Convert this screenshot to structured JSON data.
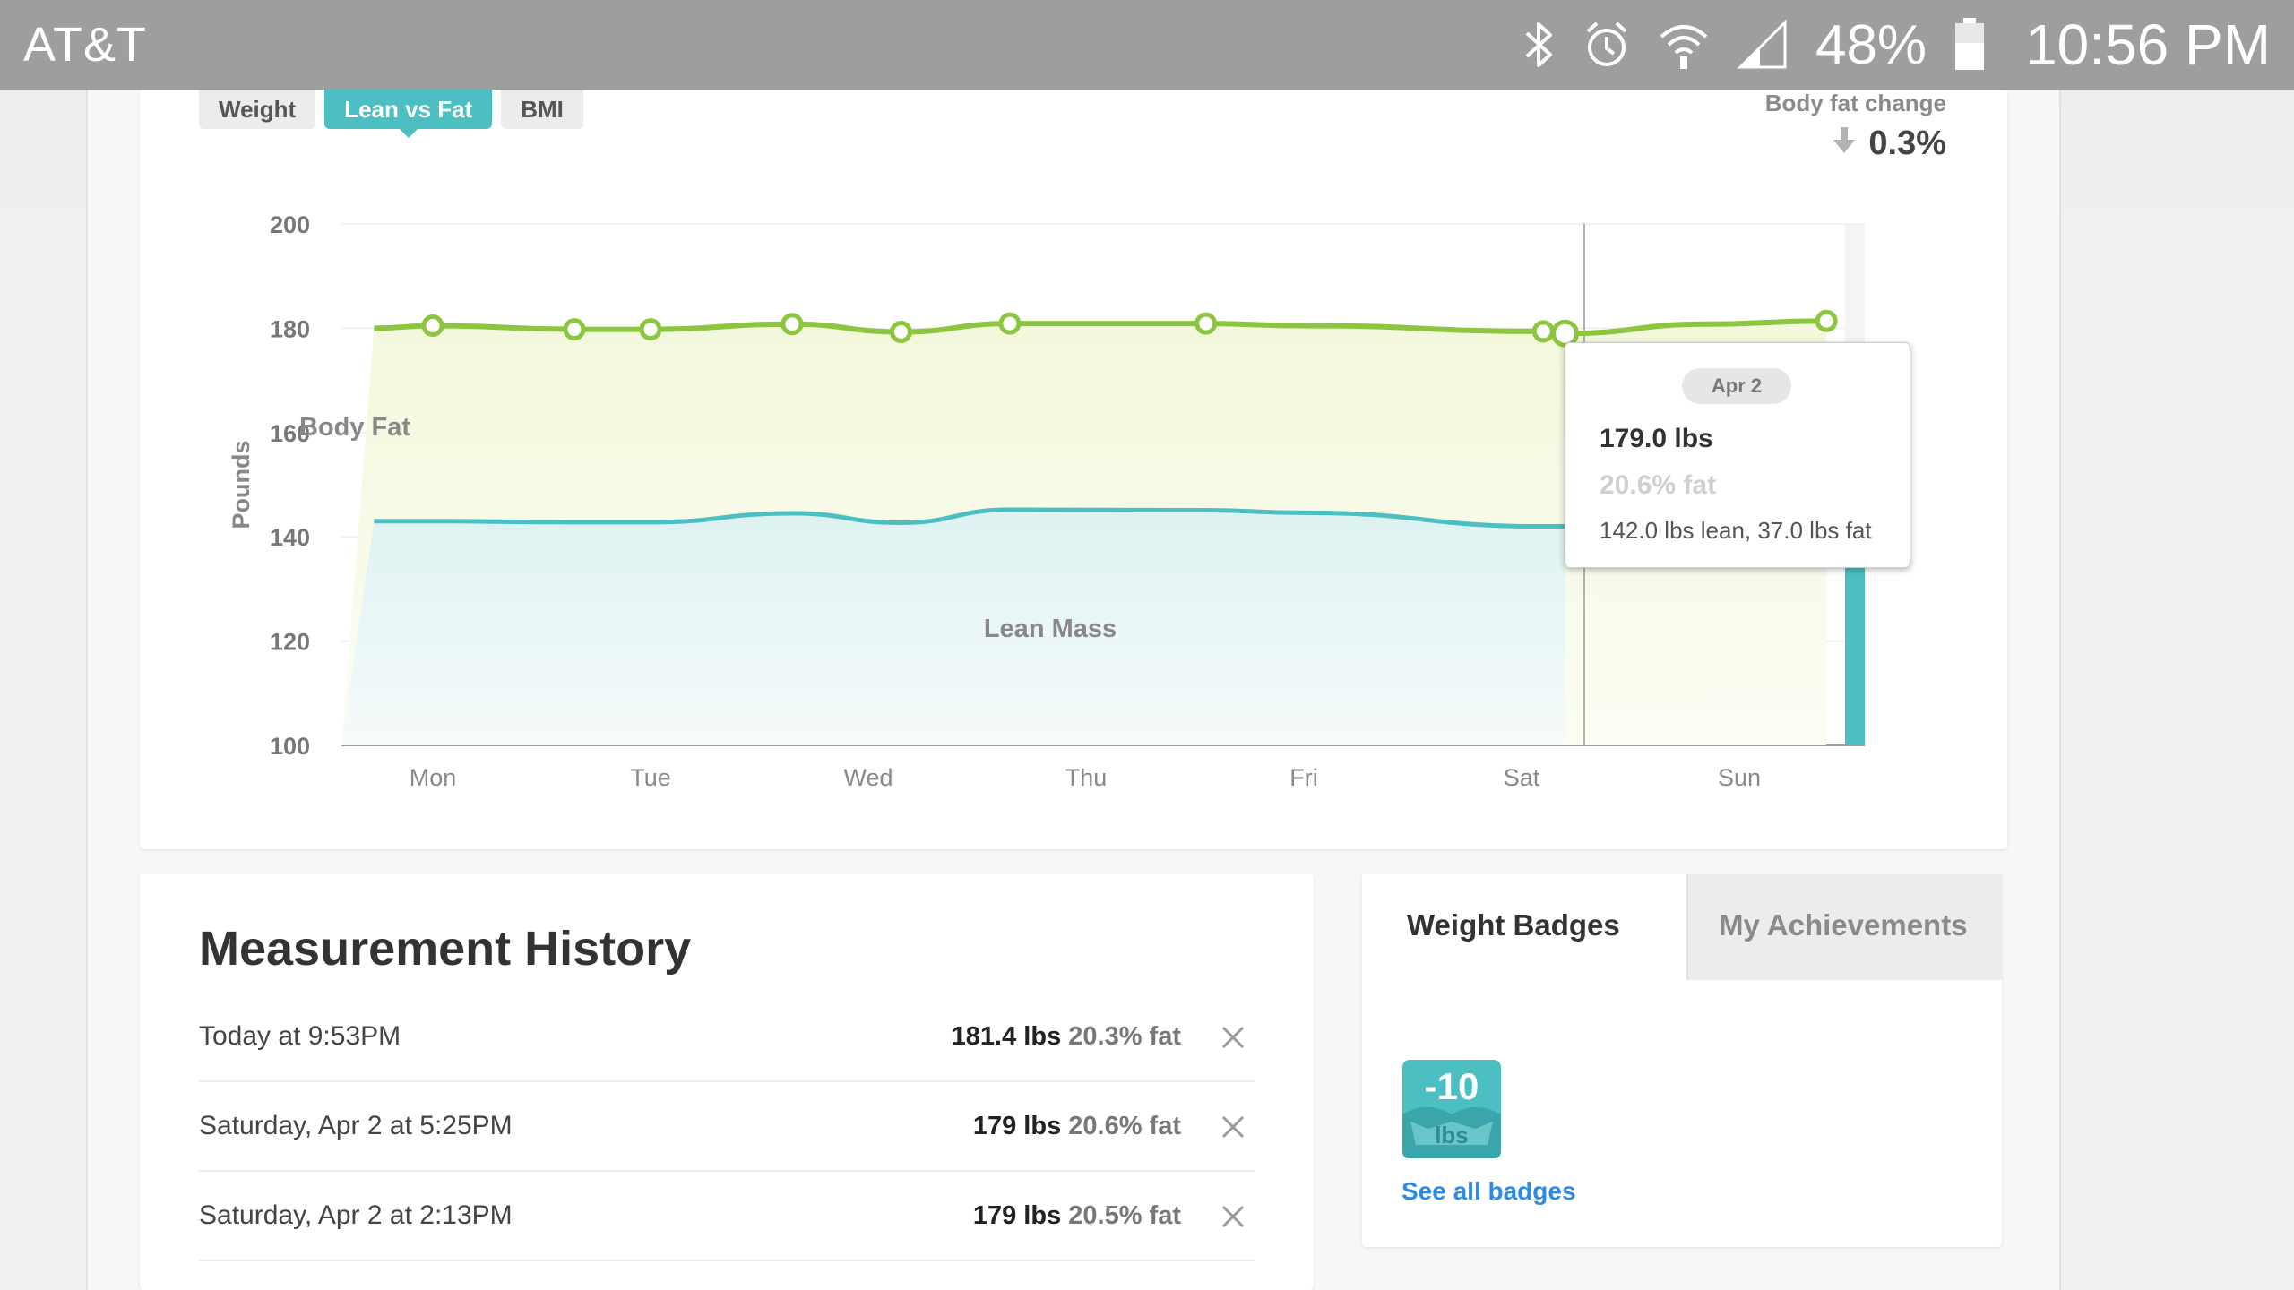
{
  "status_bar": {
    "carrier": "AT&T",
    "battery": "48%",
    "time": "10:56 PM",
    "icons": [
      "bluetooth-icon",
      "alarm-icon",
      "wifi-icon",
      "cell-signal-icon",
      "battery-icon"
    ]
  },
  "chart_tabs": [
    {
      "label": "Weight",
      "active": false
    },
    {
      "label": "Lean vs Fat",
      "active": true
    },
    {
      "label": "BMI",
      "active": false
    }
  ],
  "fat_change": {
    "label": "Body fat change",
    "value": "0.3%",
    "direction": "down"
  },
  "chart_data": {
    "type": "area",
    "ylabel": "Pounds",
    "ylim": [
      100,
      200
    ],
    "yticks": [
      100,
      120,
      140,
      160,
      180,
      200
    ],
    "categories": [
      "Mon",
      "Tue",
      "Wed",
      "Thu",
      "Fri",
      "Sat",
      "Sun"
    ],
    "area_labels": [
      "Body Fat",
      "Lean Mass"
    ],
    "series": [
      {
        "name": "Body Fat",
        "color": "#8cc63f",
        "x": [
          -0.27,
          0.0,
          0.65,
          1.0,
          1.65,
          2.15,
          2.65,
          3.55,
          4.0,
          5.1,
          5.2,
          5.85,
          6.4
        ],
        "values": [
          180.0,
          180.5,
          179.8,
          179.8,
          180.8,
          179.3,
          180.9,
          180.9,
          180.5,
          179.4,
          179.0,
          180.8,
          181.4
        ],
        "markers": [
          false,
          true,
          true,
          true,
          true,
          true,
          true,
          true,
          false,
          true,
          true,
          false,
          true
        ]
      },
      {
        "name": "Lean Mass",
        "color": "#4bbfc2",
        "x": [
          -0.27,
          0.0,
          0.65,
          1.0,
          1.65,
          2.15,
          2.65,
          3.55,
          4.0,
          5.1,
          5.2
        ],
        "values": [
          143.0,
          143.0,
          142.8,
          142.8,
          144.5,
          142.7,
          145.2,
          145.1,
          144.6,
          142.0,
          142.0
        ]
      }
    ],
    "tooltip": {
      "date": "Apr 2",
      "weight": "179.0 lbs",
      "fat": "20.6% fat",
      "detail": "142.0 lbs lean, 37.0 lbs fat"
    }
  },
  "history": {
    "title": "Measurement History",
    "rows": [
      {
        "date": "Today at 9:53PM",
        "weight": "181.4 lbs",
        "fat": "20.3% fat"
      },
      {
        "date": "Saturday, Apr 2 at 5:25PM",
        "weight": "179 lbs",
        "fat": "20.6% fat"
      },
      {
        "date": "Saturday, Apr 2 at 2:13PM",
        "weight": "179 lbs",
        "fat": "20.5% fat"
      }
    ]
  },
  "badges": {
    "tabs": [
      "Weight Badges",
      "My Achievements"
    ],
    "badge_value": "-10",
    "badge_unit": "lbs",
    "badge_color": "#4bbfc2",
    "link": "See all badges"
  }
}
